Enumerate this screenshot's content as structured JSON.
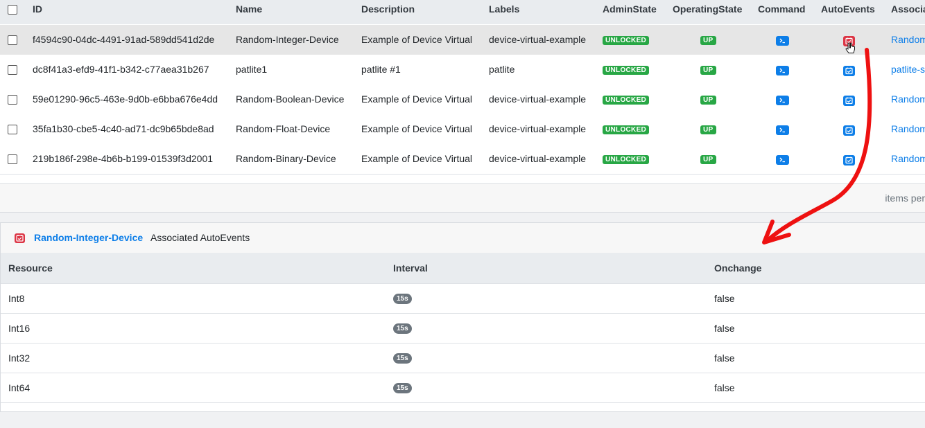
{
  "devices_table": {
    "columns": [
      "ID",
      "Name",
      "Description",
      "Labels",
      "AdminState",
      "OperatingState",
      "Command",
      "AutoEvents",
      "Associa"
    ],
    "rows": [
      {
        "id": "f4594c90-04dc-4491-91ad-589dd541d2de",
        "name": "Random-Integer-Device",
        "description": "Example of Device Virtual",
        "labels": "device-virtual-example",
        "admin_state": "UNLOCKED",
        "operating_state": "UP",
        "associated": "Random"
      },
      {
        "id": "dc8f41a3-efd9-41f1-b342-c77aea31b267",
        "name": "patlite1",
        "description": "patlite #1",
        "labels": "patlite",
        "admin_state": "UNLOCKED",
        "operating_state": "UP",
        "associated": "patlite-s"
      },
      {
        "id": "59e01290-96c5-463e-9d0b-e6bba676e4dd",
        "name": "Random-Boolean-Device",
        "description": "Example of Device Virtual",
        "labels": "device-virtual-example",
        "admin_state": "UNLOCKED",
        "operating_state": "UP",
        "associated": "Random"
      },
      {
        "id": "35fa1b30-cbe5-4c40-ad71-dc9b65bde8ad",
        "name": "Random-Float-Device",
        "description": "Example of Device Virtual",
        "labels": "device-virtual-example",
        "admin_state": "UNLOCKED",
        "operating_state": "UP",
        "associated": "Random"
      },
      {
        "id": "219b186f-298e-4b6b-b199-01539f3d2001",
        "name": "Random-Binary-Device",
        "description": "Example of Device Virtual",
        "labels": "device-virtual-example",
        "admin_state": "UNLOCKED",
        "operating_state": "UP",
        "associated": "Random"
      }
    ],
    "footer_text": "items per"
  },
  "autoevents_panel": {
    "device_name": "Random-Integer-Device",
    "title": "Associated AutoEvents",
    "columns": [
      "Resource",
      "Interval",
      "Onchange"
    ],
    "rows": [
      {
        "resource": "Int8",
        "interval": "15s",
        "onchange": "false"
      },
      {
        "resource": "Int16",
        "interval": "15s",
        "onchange": "false"
      },
      {
        "resource": "Int32",
        "interval": "15s",
        "onchange": "false"
      },
      {
        "resource": "Int64",
        "interval": "15s",
        "onchange": "false"
      }
    ]
  },
  "colors": {
    "link": "#0d7ee8",
    "success": "#28a745",
    "danger": "#dc3545",
    "annotation_arrow": "#ee1111"
  },
  "icons": {
    "command": "terminal-icon",
    "autoevents": "calendar-check-icon",
    "cursor": "hand-pointer-icon"
  }
}
